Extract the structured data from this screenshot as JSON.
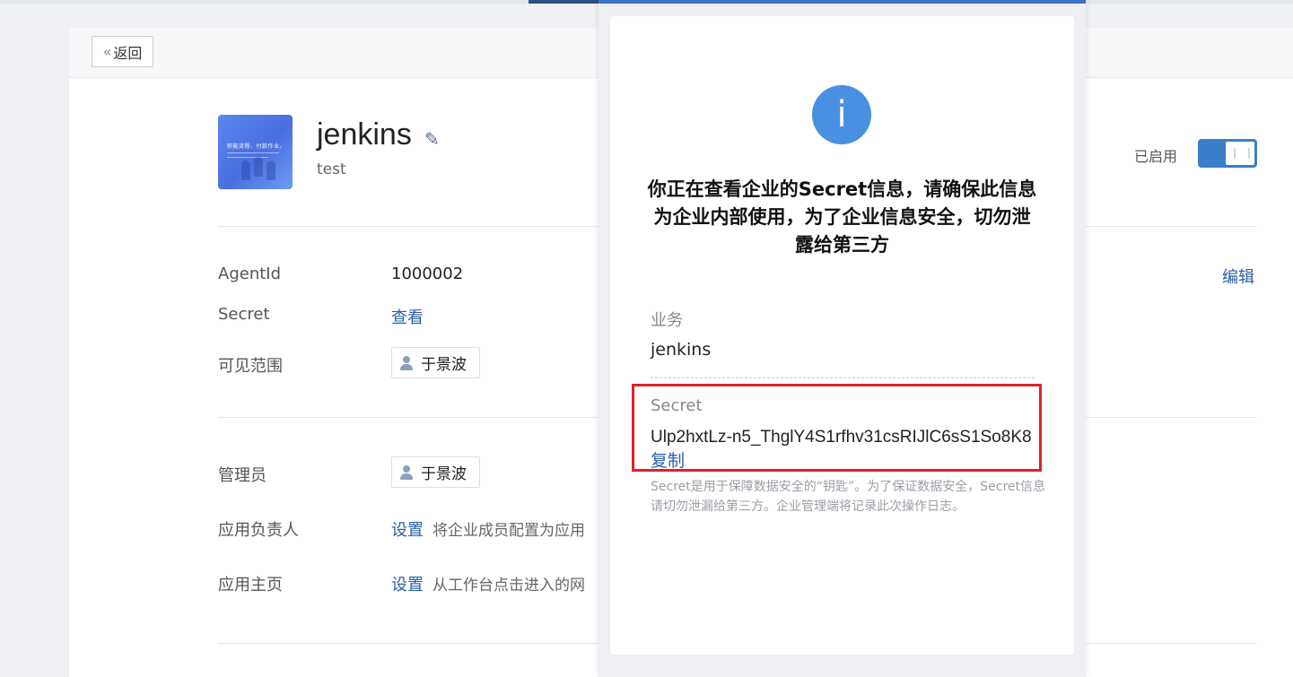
{
  "header": {
    "back_label": "返回"
  },
  "app": {
    "name": "jenkins",
    "description": "test",
    "status_label": "已启用",
    "logo_text": "职能流程、付款作业。"
  },
  "fields": {
    "agentid_label": "AgentId",
    "agentid_value": "1000002",
    "secret_label": "Secret",
    "secret_link": "查看",
    "visible_label": "可见范围",
    "visible_member": "于景波",
    "edit_link": "编辑",
    "admin_label": "管理员",
    "admin_member": "于景波",
    "owner_label": "应用负责人",
    "owner_link": "设置",
    "owner_hint": "将企业成员配置为应用",
    "homepage_label": "应用主页",
    "homepage_link": "设置",
    "homepage_hint": "从工作台点击进入的网"
  },
  "dialog": {
    "warning": "你正在查看企业的Secret信息，请确保此信息为企业内部使用，为了企业信息安全，切勿泄露给第三方",
    "biz_label": "业务",
    "biz_value": "jenkins",
    "secret_label": "Secret",
    "secret_value": "Ulp2hxtLz-n5_ThglY4S1rfhv31csRIJlC6sS1So8K8",
    "copy_label": "复制",
    "note": "Secret是用于保障数据安全的“钥匙”。为了保证数据安全，Secret信息请切勿泄漏给第三方。企业管理端将记录此次操作日志。"
  },
  "colors": {
    "accent": "#3a7fc9",
    "link": "#2a5fa8",
    "info": "#4a90e2",
    "highlight": "#d9232e"
  },
  "icons": {
    "back": "double-chevron-left-icon",
    "edit": "pencil-icon",
    "member": "person-icon",
    "info": "info-icon"
  }
}
